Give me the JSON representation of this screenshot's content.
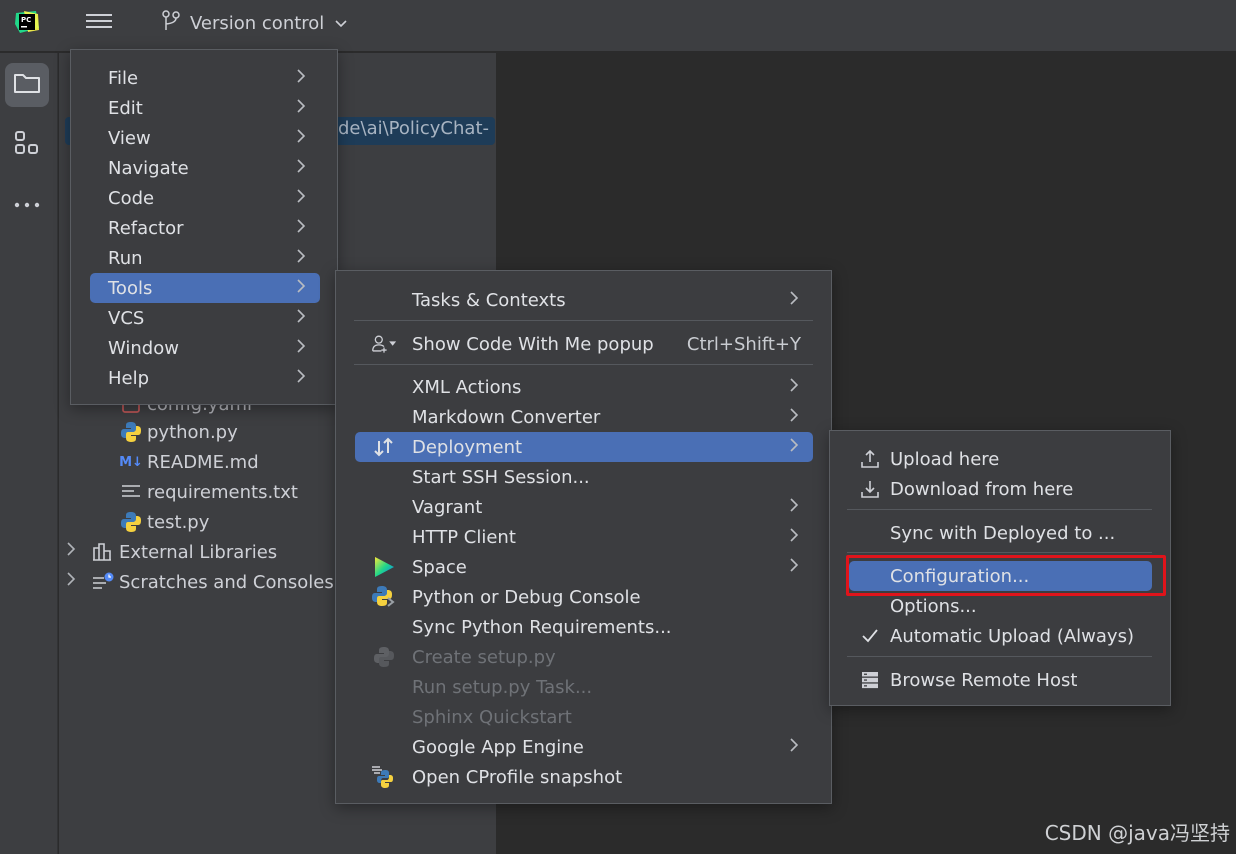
{
  "titlebar": {
    "app_icon": "pycharm-logo-icon",
    "main_menu_icon": "hamburger-icon",
    "vcs_icon": "branch-icon",
    "vcs_label": "Version control",
    "vcs_dropdown_icon": "chevron-down-icon"
  },
  "toolstrip": {
    "items": [
      {
        "icon": "folder-icon",
        "label": "Project",
        "active": true
      },
      {
        "icon": "structure-icon",
        "label": "Structure",
        "active": false
      },
      {
        "icon": "more-icon",
        "label": "More",
        "active": false
      }
    ]
  },
  "project_panel": {
    "path_fragment": "de\\ai\\PolicyChat-",
    "partial_item": "config.yaml",
    "files": [
      {
        "name": "python.py",
        "icon": "python-file-icon"
      },
      {
        "name": "README.md",
        "icon": "markdown-file-icon"
      },
      {
        "name": "requirements.txt",
        "icon": "text-file-icon"
      },
      {
        "name": "test.py",
        "icon": "python-file-icon"
      }
    ],
    "roots": [
      {
        "name": "External Libraries",
        "icon": "libraries-icon"
      },
      {
        "name": "Scratches and Consoles",
        "icon": "scratches-icon"
      }
    ]
  },
  "main_menu": {
    "items": [
      {
        "label": "File",
        "submenu": true
      },
      {
        "label": "Edit",
        "submenu": true
      },
      {
        "label": "View",
        "submenu": true
      },
      {
        "label": "Navigate",
        "submenu": true
      },
      {
        "label": "Code",
        "submenu": true
      },
      {
        "label": "Refactor",
        "submenu": true
      },
      {
        "label": "Run",
        "submenu": true
      },
      {
        "label": "Tools",
        "submenu": true,
        "selected": true
      },
      {
        "label": "VCS",
        "submenu": true
      },
      {
        "label": "Window",
        "submenu": true
      },
      {
        "label": "Help",
        "submenu": true
      }
    ]
  },
  "tools_menu": {
    "items": [
      {
        "label": "Tasks & Contexts",
        "submenu": true
      },
      {
        "label": "Show Code With Me popup",
        "shortcut": "Ctrl+Shift+Y",
        "icon": "code-with-me-icon"
      },
      {
        "label": "XML Actions",
        "submenu": true
      },
      {
        "label": "Markdown Converter",
        "submenu": true
      },
      {
        "label": "Deployment",
        "submenu": true,
        "selected": true,
        "icon": "deployment-icon"
      },
      {
        "label": "Start SSH Session..."
      },
      {
        "label": "Vagrant",
        "submenu": true
      },
      {
        "label": "HTTP Client",
        "submenu": true
      },
      {
        "label": "Space",
        "submenu": true,
        "icon": "space-icon"
      },
      {
        "label": "Python or Debug Console",
        "icon": "python-console-icon"
      },
      {
        "label": "Sync Python Requirements..."
      },
      {
        "label": "Create setup.py",
        "disabled": true,
        "icon": "python-icon"
      },
      {
        "label": "Run setup.py Task...",
        "disabled": true
      },
      {
        "label": "Sphinx Quickstart",
        "disabled": true
      },
      {
        "label": "Google App Engine",
        "submenu": true
      },
      {
        "label": "Open CProfile snapshot",
        "icon": "cprofile-icon"
      }
    ]
  },
  "deployment_menu": {
    "items": [
      {
        "label": "Upload here",
        "icon": "upload-icon"
      },
      {
        "label": "Download from here",
        "icon": "download-icon"
      },
      {
        "label": "Sync with Deployed to ..."
      },
      {
        "label": "Configuration...",
        "selected": true,
        "highlighted_annotation": true
      },
      {
        "label": "Options..."
      },
      {
        "label": "Automatic Upload (Always)",
        "checked": true,
        "icon": "checkmark-icon"
      },
      {
        "label": "Browse Remote Host",
        "icon": "server-icon"
      }
    ]
  },
  "colors": {
    "selection": "#4a6fb5",
    "annotation_box": "#e0141b",
    "menu_bg": "#3c3d40"
  },
  "watermark": "CSDN @java冯坚持"
}
